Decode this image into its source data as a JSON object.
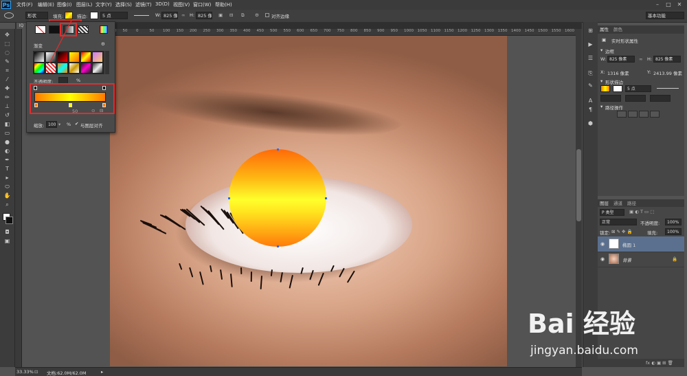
{
  "app": {
    "logo": "Ps"
  },
  "menu": [
    "文件(F)",
    "编辑(E)",
    "图像(I)",
    "图层(L)",
    "文字(Y)",
    "选择(S)",
    "滤镜(T)",
    "3D(D)",
    "视图(V)",
    "窗口(W)",
    "帮助(H)"
  ],
  "options": {
    "mode": "形状",
    "fill_label": "填充:",
    "stroke_label": "描边:",
    "stroke_width": "5 点",
    "w_label": "W:",
    "w_value": "825 像素",
    "h_label": "H:",
    "h_value": "825 像素",
    "align_edges_label": "对齐边缘",
    "workspace": "基本功能"
  },
  "ruler_ticks": [
    "400",
    "350",
    "300",
    "250",
    "200",
    "150",
    "100",
    "50",
    "0",
    "50",
    "100",
    "150",
    "200",
    "250",
    "300",
    "350",
    "400",
    "450",
    "500",
    "550",
    "600",
    "650",
    "700",
    "750",
    "800",
    "850",
    "900",
    "950",
    "1000",
    "1050",
    "1100",
    "1150",
    "1200",
    "1250",
    "1300",
    "1350",
    "1400",
    "1450",
    "1500",
    "1550",
    "1600"
  ],
  "doc_tab": "IQ",
  "status": {
    "zoom": "33.33%",
    "doc": "文档:62.0M/62.0M"
  },
  "gradient_picker": {
    "section_label": "渐变",
    "opacity_label": "不透明度:",
    "opacity_unit": "%",
    "location_value": "50",
    "scale_label": "缩放:",
    "scale_value": "100",
    "scale_unit": "%",
    "align_label": "与图层对齐",
    "colors": {
      "left": "#ff7a00",
      "mid": "#ffff00",
      "right": "#ff7a00"
    }
  },
  "properties_panel": {
    "tabs": [
      "属性",
      "颜色"
    ],
    "title": "实时形状属性",
    "border_label": "边框",
    "w_label": "W:",
    "w_value": "825 像素",
    "h_label": "H:",
    "h_value": "825 像素",
    "x_label": "X:",
    "x_value": "1316 像素",
    "y_label": "Y:",
    "y_value": "2413.99 像素",
    "shape_section": "形状描边",
    "stroke_value": "5 点",
    "path_ops": "路径操作"
  },
  "layers_panel": {
    "tabs": [
      "图层",
      "通道",
      "路径"
    ],
    "kind": "P 类型",
    "blend": "正常",
    "opacity_label": "不透明度:",
    "opacity_value": "100%",
    "lock_label": "锁定:",
    "fill_label": "填充:",
    "fill_value": "100%",
    "layers": [
      {
        "name": "椭圆 1",
        "selected": true
      },
      {
        "name": "背景",
        "selected": false
      }
    ]
  },
  "watermark": {
    "logo": "Bai 经验",
    "url": "jingyan.baidu.com"
  }
}
